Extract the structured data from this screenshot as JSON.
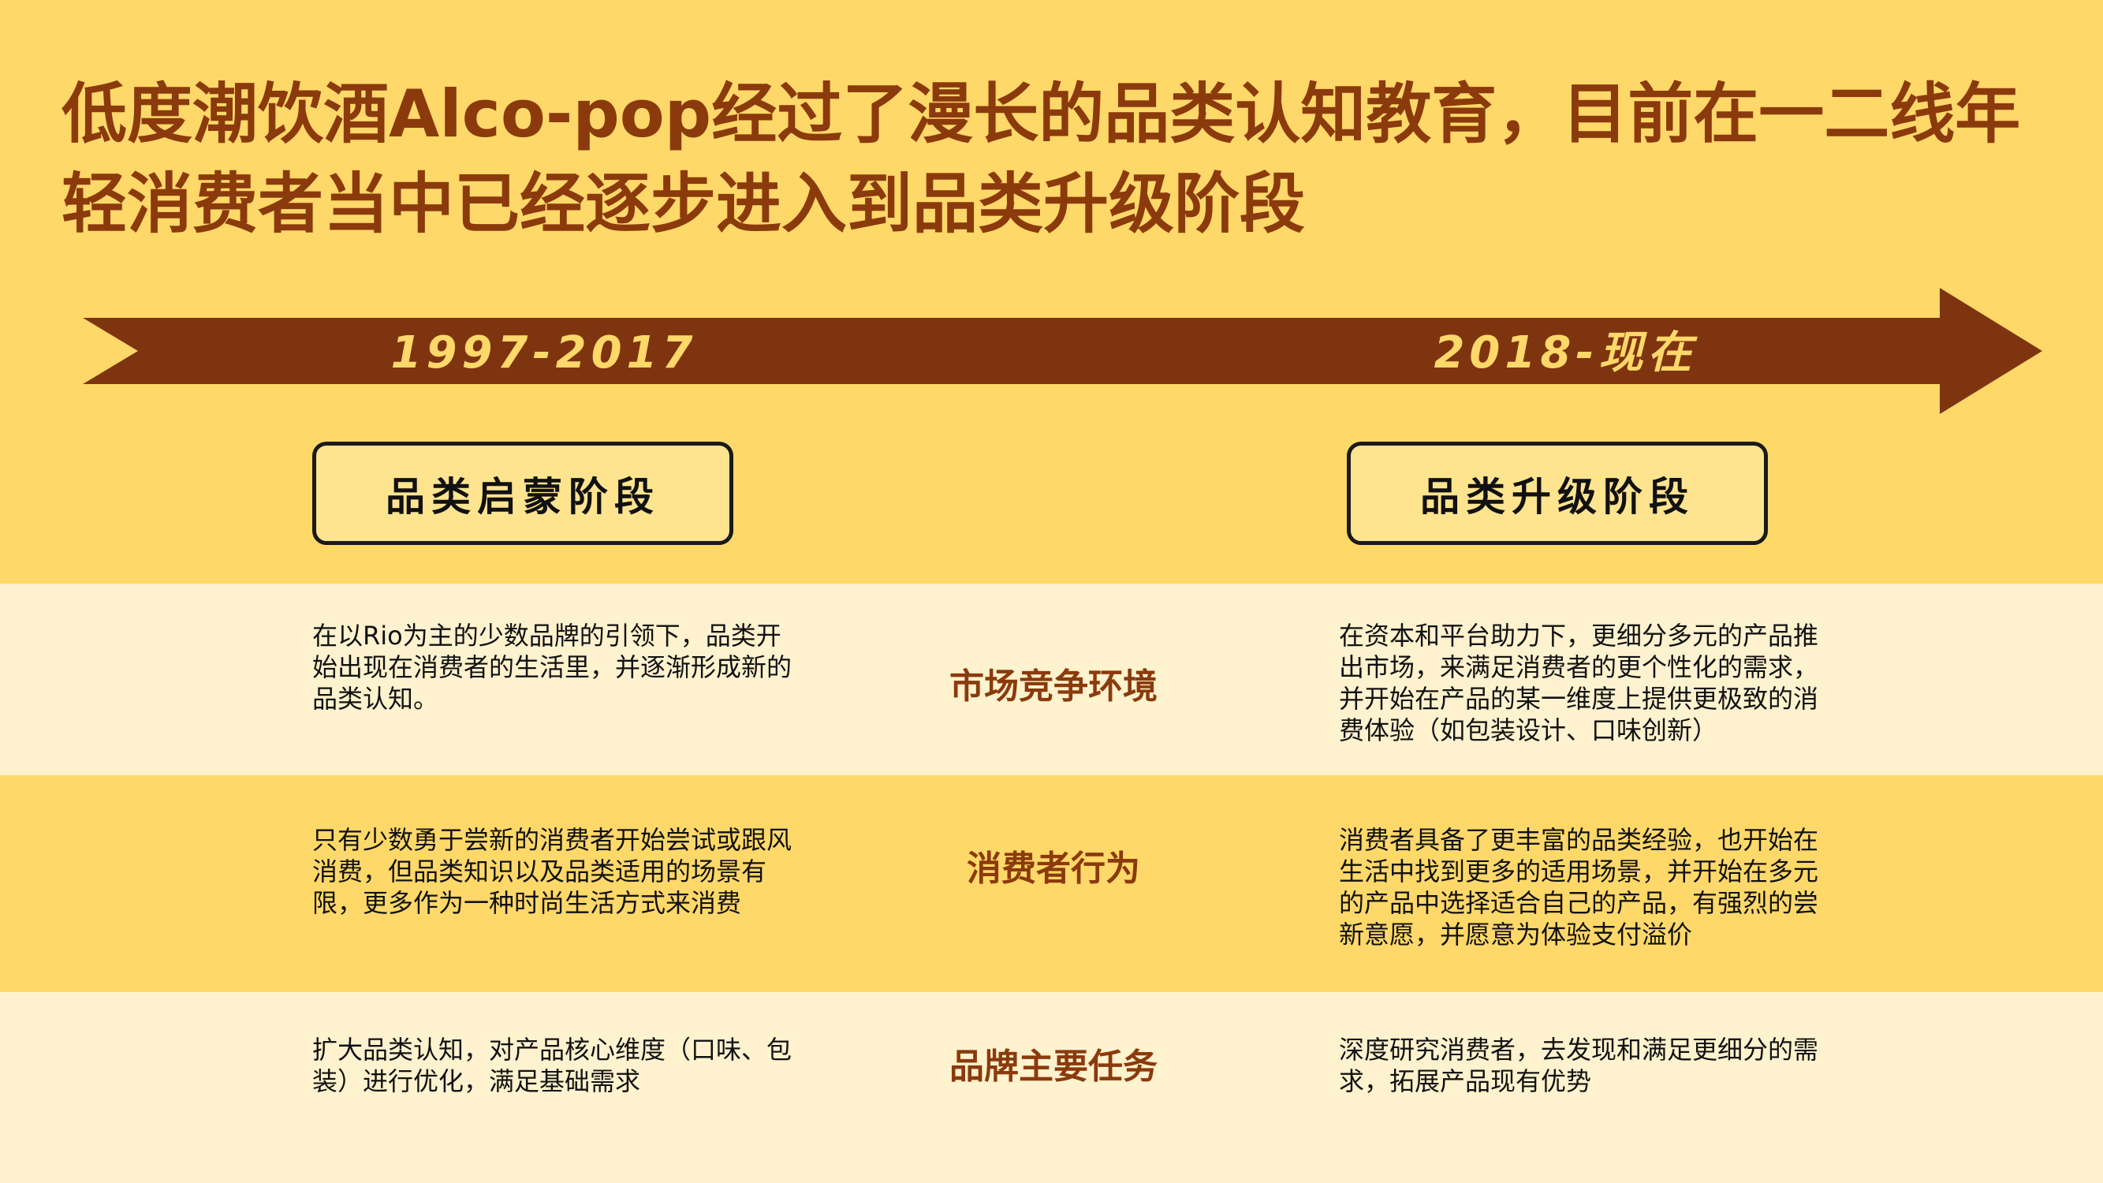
{
  "title": "低度潮饮酒Alco-pop经过了漫长的品类认知教育，目前在一二线年轻消费者当中已经逐步进入到品类升级阶段",
  "timeline": {
    "period_1": "1997-2017",
    "period_2": "2018-现在"
  },
  "stages": {
    "stage_1": "品类启蒙阶段",
    "stage_2": "品类升级阶段"
  },
  "rows": [
    {
      "label": "市场竞争环境",
      "left": "在以Rio为主的少数品牌的引领下，品类开始出现在消费者的生活里，并逐渐形成新的品类认知。",
      "right": "在资本和平台助力下，更细分多元的产品推出市场，来满足消费者的更个性化的需求，并开始在产品的某一维度上提供更极致的消费体验（如包装设计、口味创新）"
    },
    {
      "label": "消费者行为",
      "left": "只有少数勇于尝新的消费者开始尝试或跟风消费，但品类知识以及品类适用的场景有限，更多作为一种时尚生活方式来消费",
      "right": "消费者具备了更丰富的品类经验，也开始在生活中找到更多的适用场景，并开始在多元的产品中选择适合自己的产品，有强烈的尝新意愿，并愿意为体验支付溢价"
    },
    {
      "label": "品牌主要任务",
      "left": "扩大品类认知，对产品核心维度（口味、包装）进行优化，满足基础需求",
      "right": "深度研究消费者，去发现和满足更细分的需求，拓展产品现有优势"
    }
  ],
  "colors": {
    "background": "#FFD86A",
    "band_light": "#FFF2CE",
    "brown": "#8B3A0C",
    "arrow": "#7F3410",
    "box_fill": "#FFE490"
  }
}
